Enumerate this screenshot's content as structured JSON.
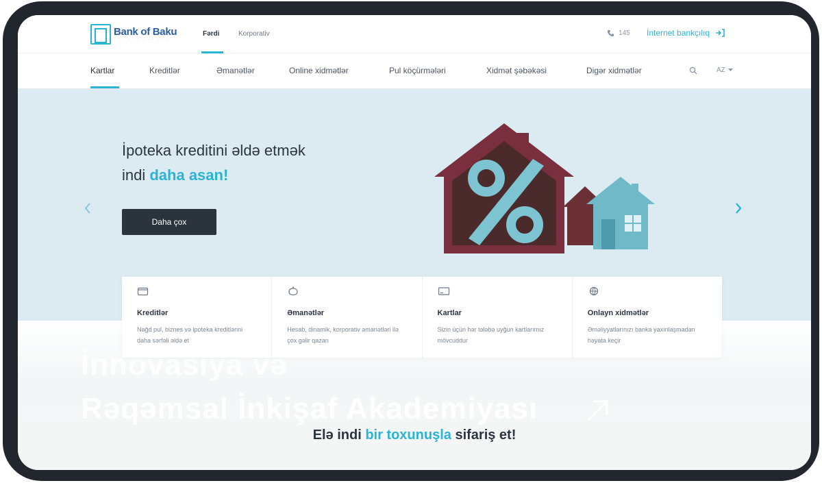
{
  "brand": {
    "name": "Bank of Baku",
    "tagline": "· · · · · · · · · · · ·"
  },
  "segments": [
    {
      "label": "Fərdi",
      "active": true
    },
    {
      "label": "Korporativ",
      "active": false
    }
  ],
  "contact": {
    "phone": "145",
    "internet_banking": "İnternet bankçılıq"
  },
  "nav": {
    "items": [
      "Kartlar",
      "Kreditlər",
      "Əmanətlər",
      "Online xidmətlər",
      "Pul köçürmələri",
      "Xidmət şəbəkəsi",
      "Digər xidmətlər"
    ],
    "active": "Kartlar",
    "language": "AZ"
  },
  "hero": {
    "line1": "İpoteka kreditini əldə etmək",
    "line2_prefix": "indi ",
    "line2_accent": "daha asan!",
    "cta": "Daha çox"
  },
  "cards": [
    {
      "icon": "wallet-icon",
      "title": "Kreditlər",
      "desc": "Nağd pul, biznes və ipoteka kreditlərini daha sərfəli əldə et"
    },
    {
      "icon": "piggy-bank-icon",
      "title": "Əmanətlər",
      "desc": "Hesab, dinamik, korporativ əmanətləri ilə çox gəlir qazan"
    },
    {
      "icon": "card-icon",
      "title": "Kartlar",
      "desc": "Sizin üçün hər tələbə uyğun kartlarımız mövcuddur"
    },
    {
      "icon": "globe-icon",
      "title": "Onlayn xidmətlər",
      "desc": "Əməliyyatlarınızı banka yaxınlaşmadan həyata keçir"
    }
  ],
  "ghost": {
    "line1": "İnnovasiya və",
    "line2": "Rəqəmsal İnkişaf Akademiyası"
  },
  "bottom_cta": {
    "prefix": "Elə indi ",
    "accent": "bir toxunuşla",
    "suffix": " sifariş et!"
  },
  "colors": {
    "accent": "#2bb3d4",
    "dark": "#2b333c",
    "hero_bg": "#dcebf1",
    "house_red": "#7a2f3e",
    "house_blue": "#6fb9c9"
  }
}
